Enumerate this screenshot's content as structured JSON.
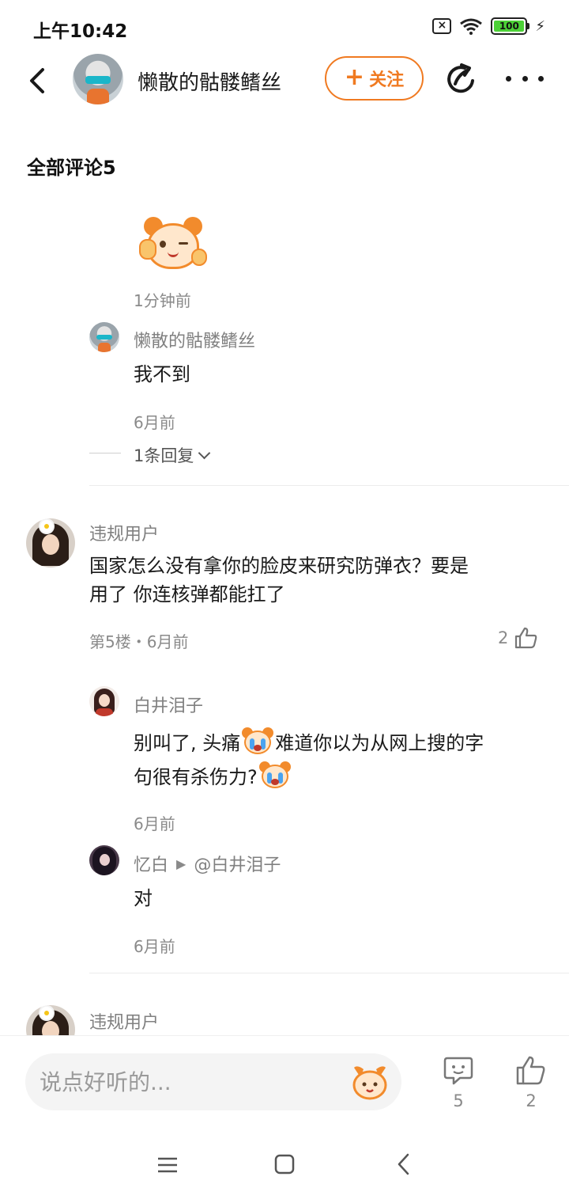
{
  "status_bar": {
    "time": "上午10:42",
    "battery": "100"
  },
  "header": {
    "username": "懒散的骷髅鳍丝",
    "follow_label": "关注",
    "follow_plus": "+"
  },
  "section": {
    "title": "全部评论5"
  },
  "first_comment": {
    "time": "1分钟前",
    "reply": {
      "author": "懒散的骷髅鳍丝",
      "text": "我不到",
      "time": "6月前"
    },
    "reply_toggle": "1条回复"
  },
  "floor5": {
    "author": "违规用户",
    "text_line1": " 国家怎么没有拿你的脸皮来研究防弹衣？要是",
    "text_line2": "用了 你连核弹都能扛了",
    "meta": "第5楼・6月前",
    "likes": "2",
    "replies": [
      {
        "author": "白井泪子",
        "text_a": "别叫了, 头痛",
        "text_b": "难道你以为从网上搜的字",
        "text_c": "句很有杀伤力?",
        "time": "6月前"
      },
      {
        "author": "忆白",
        "reply_to": "@白井泪子",
        "text": "对",
        "time": "6月前"
      }
    ]
  },
  "floor4_partial": {
    "author": "违规用户"
  },
  "bottom_bar": {
    "input_placeholder": "说点好听的...",
    "comment_count": "5",
    "like_count": "2"
  },
  "colors": {
    "accent": "#f07a21",
    "text_primary": "#1a1a1a",
    "text_secondary": "#8a8a8a"
  }
}
